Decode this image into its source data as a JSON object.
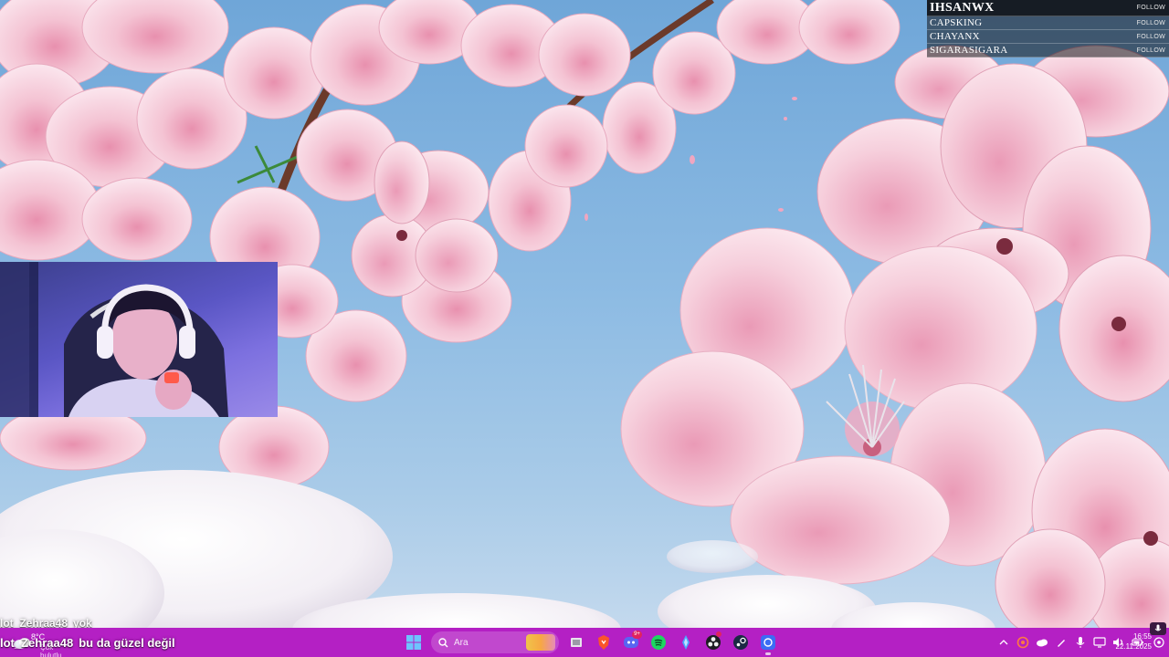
{
  "follow_list": {
    "rows": [
      {
        "name": "IHSANWX",
        "action": "FOLLOW"
      },
      {
        "name": "CAPSKING",
        "action": "FOLLOW"
      },
      {
        "name": "CHAYANX",
        "action": "FOLLOW"
      },
      {
        "name": "SIGARASIGARA",
        "action": "FOLLOW"
      }
    ]
  },
  "chat": {
    "messages": [
      {
        "user": "lot_Zehraa48",
        "text": "yok"
      },
      {
        "user": "lot_Zehraa48",
        "text": "bu da güzel değil"
      }
    ]
  },
  "taskbar": {
    "weather": {
      "temp": "8°C",
      "condition": "Çok bulutlu",
      "icon": "cloud-icon"
    },
    "search_placeholder": "Ara",
    "apps": [
      {
        "name": "start-icon"
      },
      {
        "name": "task-view-icon"
      },
      {
        "name": "brave-browser-icon"
      },
      {
        "name": "discord-icon",
        "badge": "9+"
      },
      {
        "name": "spotify-icon"
      },
      {
        "name": "app-icon"
      },
      {
        "name": "obs-icon"
      },
      {
        "name": "steam-icon"
      },
      {
        "name": "browser-icon",
        "active": true
      }
    ],
    "tray": [
      "chevron-up-icon",
      "app-tray-icon",
      "onedrive-icon",
      "pen-icon",
      "mic-icon",
      "network-icon",
      "volume-icon",
      "battery-icon"
    ],
    "clock": {
      "time": "16:55",
      "date": "22.11.2025"
    }
  },
  "colors": {
    "taskbar": "#b420c4",
    "sky": "#8dbbe3",
    "blossom": "#f3c4d2"
  }
}
